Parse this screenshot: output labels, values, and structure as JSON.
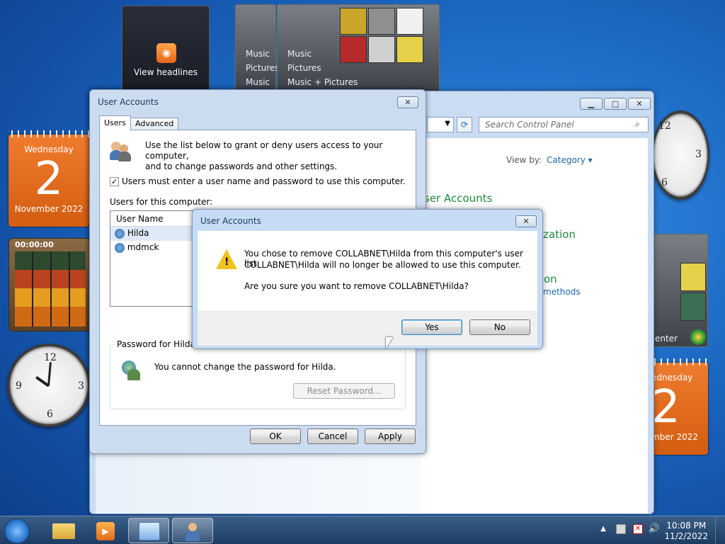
{
  "gadgets": {
    "feed_label": "View headlines",
    "media_small": [
      "Music",
      "Pictures",
      "Music"
    ],
    "media_large": [
      "Music",
      "Pictures",
      "Music + Pictures"
    ],
    "cal_left": {
      "weekday": "Wednesday",
      "day": "2",
      "month": "November 2022"
    },
    "cal_right": {
      "weekday": "ednesday",
      "day": "2",
      "month": "mber 2022"
    },
    "puzzle_timer": "00:00:00",
    "media_right_label": "enter"
  },
  "control_panel": {
    "search_placeholder": "Search Control Panel",
    "view_by_label": "View by:",
    "view_by_value": "Category",
    "partial_links": [
      "ser Accounts",
      "ization",
      "on",
      "methods"
    ]
  },
  "user_accounts": {
    "title": "User Accounts",
    "tabs": [
      "Users",
      "Advanced"
    ],
    "intro": [
      "Use the list below to grant or deny users access to your computer,",
      "and to change passwords and other settings."
    ],
    "checkbox_label": "Users must enter a user name and password to use this computer.",
    "users_label": "Users for this computer:",
    "col_user_name": "User Name",
    "users": [
      "Hilda",
      "mdmck"
    ],
    "password_group": "Password for Hilda",
    "password_msg": "You cannot change the password for Hilda.",
    "reset_btn": "Reset Password...",
    "ok": "OK",
    "cancel": "Cancel",
    "apply": "Apply"
  },
  "dialog": {
    "title": "User Accounts",
    "line1": "You chose to remove COLLABNET\\Hilda from this computer's user list.",
    "line2": "COLLABNET\\Hilda will no longer be allowed to use this computer.",
    "line3": "Are you sure you want to remove COLLABNET\\Hilda?",
    "yes": "Yes",
    "no": "No"
  },
  "taskbar": {
    "time": "10:08 PM",
    "date": "11/2/2022"
  },
  "colors": {
    "accent": "#1e395b",
    "link": "#1e66aa",
    "calendar": "#e06a1c"
  }
}
